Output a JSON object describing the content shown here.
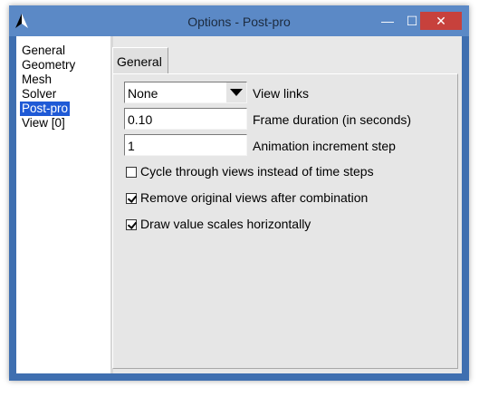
{
  "window": {
    "title": "Options - Post-pro",
    "minimize_glyph": "—",
    "maximize_glyph": "☐",
    "close_glyph": "✕"
  },
  "sidebar": {
    "items": [
      {
        "label": "General",
        "selected": false
      },
      {
        "label": "Geometry",
        "selected": false
      },
      {
        "label": "Mesh",
        "selected": false
      },
      {
        "label": "Solver",
        "selected": false
      },
      {
        "label": "Post-pro",
        "selected": true
      },
      {
        "label": "View [0]",
        "selected": false
      }
    ]
  },
  "tabs": [
    {
      "label": "General",
      "active": true
    }
  ],
  "form": {
    "view_links": {
      "value": "None",
      "label": "View links"
    },
    "frame_duration": {
      "value": "0.10",
      "label": "Frame duration (in seconds)"
    },
    "animation_step": {
      "value": "1",
      "label": "Animation increment step"
    },
    "checkboxes": [
      {
        "label": "Cycle through views instead of time steps",
        "checked": false
      },
      {
        "label": "Remove original views after combination",
        "checked": true
      },
      {
        "label": "Draw value scales horizontally",
        "checked": true
      }
    ]
  },
  "colors": {
    "title_bar": "#5b89c6",
    "close_button": "#c7413c",
    "selection": "#1f5ad6"
  },
  "icons": {
    "app": "gmsh-logo-icon",
    "dropdown": "chevron-down-icon"
  }
}
